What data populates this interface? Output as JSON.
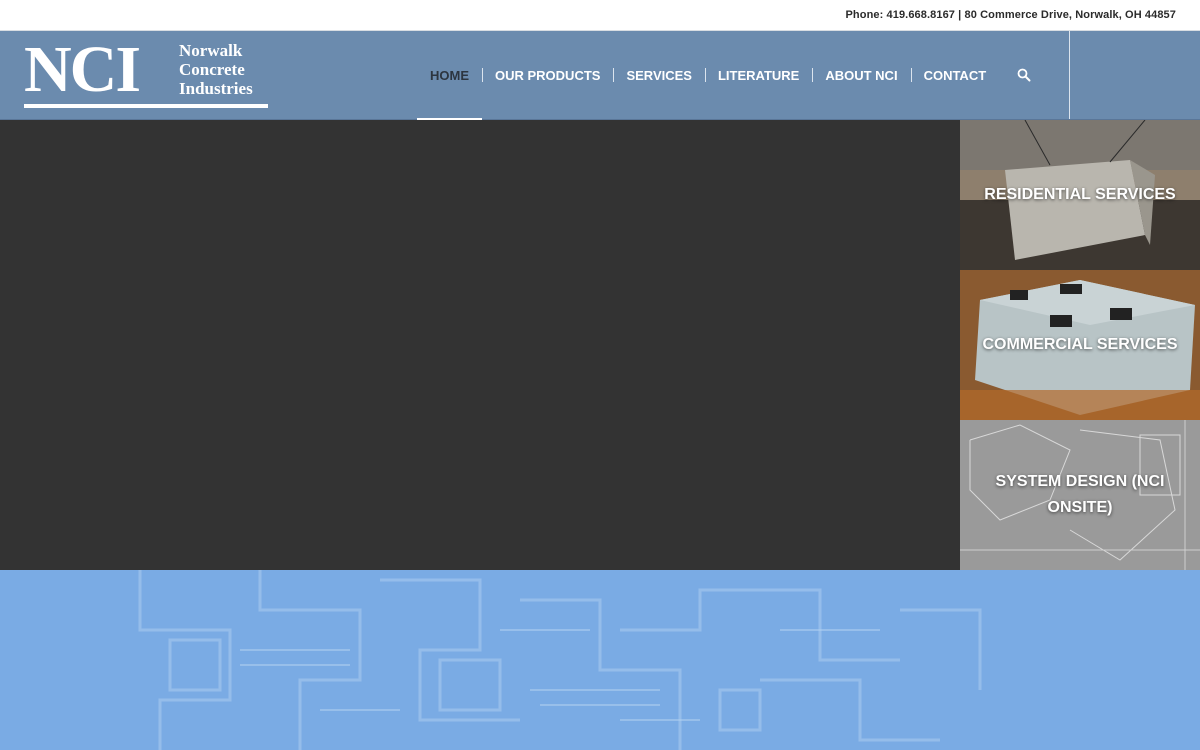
{
  "topbar": {
    "contact": "Phone: 419.668.8167 | 80 Commerce Drive, Norwalk, OH 44857"
  },
  "logo": {
    "mark": "NCI",
    "line1": "Norwalk",
    "line2": "Concrete",
    "line3": "Industries"
  },
  "nav": {
    "items": [
      {
        "label": "HOME",
        "active": true
      },
      {
        "label": "OUR PRODUCTS",
        "active": false
      },
      {
        "label": "SERVICES",
        "active": false
      },
      {
        "label": "LITERATURE",
        "active": false
      },
      {
        "label": "ABOUT NCI",
        "active": false
      },
      {
        "label": "CONTACT",
        "active": false
      }
    ],
    "search_icon": "search-icon"
  },
  "tiles": [
    {
      "label": "RESIDENTIAL SERVICES"
    },
    {
      "label": "COMMERCIAL SERVICES"
    },
    {
      "label": "SYSTEM DESIGN (NCI ONSITE)"
    }
  ],
  "colors": {
    "header_bg": "#6b8bae",
    "hero_bg": "#333333",
    "blueprint_bg": "#7aabe4",
    "active_nav": "#2c3540"
  }
}
